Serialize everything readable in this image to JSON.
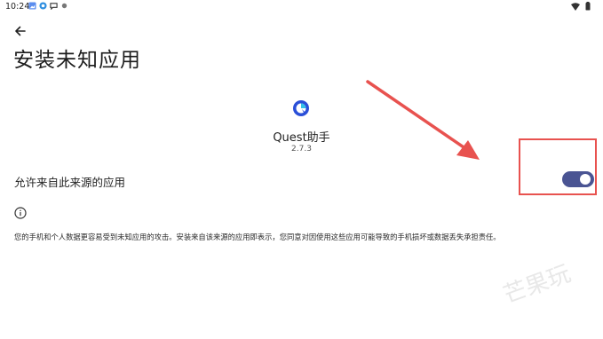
{
  "status_bar": {
    "time": "10:24"
  },
  "page": {
    "title": "安装未知应用"
  },
  "app": {
    "name": "Quest助手",
    "version": "2.7.3"
  },
  "setting": {
    "label": "允许来自此来源的应用",
    "enabled": true
  },
  "warning": {
    "text": "您的手机和个人数据更容易受到未知应用的攻击。安装来自该来源的应用即表示，您同意对因使用这些应用可能导致的手机损坏或数据丢失承担责任。"
  },
  "colors": {
    "toggle_on": "#4a5493",
    "annotation": "#e8524f",
    "background": "#ffffff"
  },
  "icons": [
    "arrow-back-icon",
    "info-icon",
    "wifi-icon",
    "battery-icon",
    "app-icon"
  ],
  "watermark": {
    "text": "芒果玩"
  }
}
